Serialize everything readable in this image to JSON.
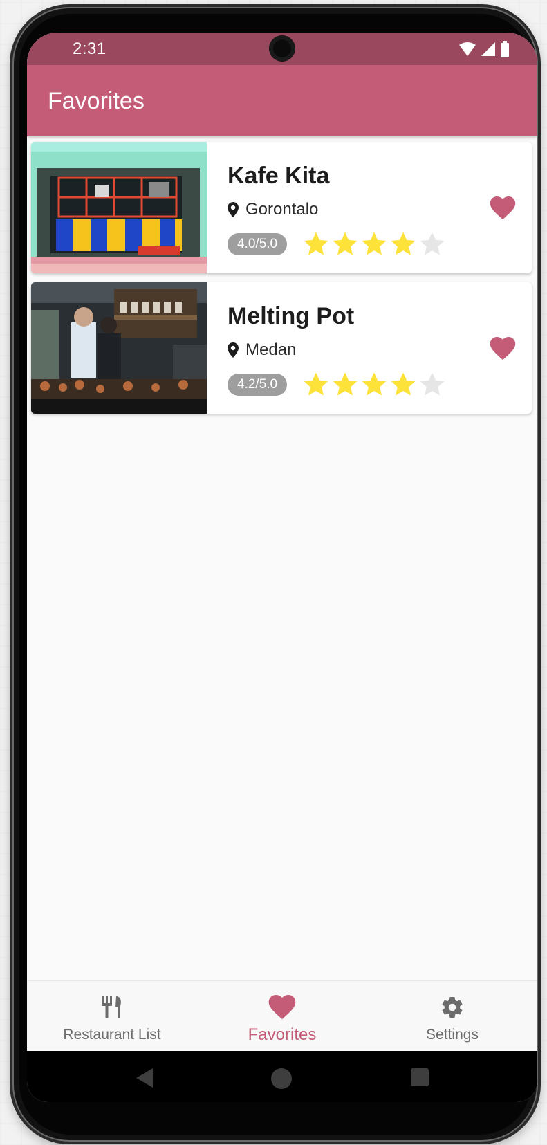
{
  "status_bar": {
    "time": "2:31",
    "icons": [
      "wifi-icon",
      "signal-icon",
      "battery-icon"
    ]
  },
  "app_bar": {
    "title": "Favorites"
  },
  "restaurants": [
    {
      "name": "Kafe Kita",
      "city": "Gorontalo",
      "rating_text": "4.0/5.0",
      "rating": 4.0,
      "max_rating": 5,
      "favorited": true
    },
    {
      "name": "Melting Pot",
      "city": "Medan",
      "rating_text": "4.2/5.0",
      "rating": 4.2,
      "max_rating": 5,
      "favorited": true
    }
  ],
  "bottom_nav": {
    "items": [
      {
        "label": "Restaurant List",
        "icon": "restaurant-icon",
        "active": false
      },
      {
        "label": "Favorites",
        "icon": "heart-icon",
        "active": true
      },
      {
        "label": "Settings",
        "icon": "gear-icon",
        "active": false
      }
    ]
  },
  "system_nav": [
    "back-icon",
    "home-icon",
    "recents-icon"
  ],
  "colors": {
    "status_bar": "#99485e",
    "app_bar": "#c45b77",
    "accent": "#c45b77",
    "star_filled": "#fde23a",
    "star_empty": "#e6e6e6",
    "badge": "#9e9e9e"
  }
}
